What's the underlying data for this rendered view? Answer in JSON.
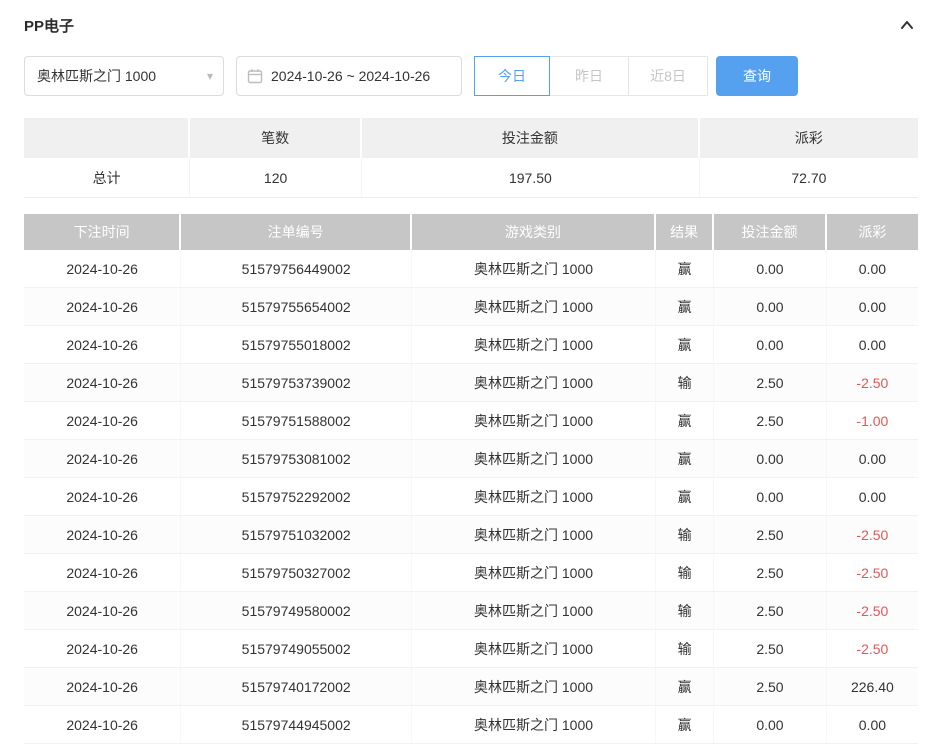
{
  "page": {
    "title": "PP电子"
  },
  "filters": {
    "game_select": "奥林匹斯之门 1000",
    "date_range": "2024-10-26 ~ 2024-10-26",
    "quick_buttons": [
      {
        "label": "今日",
        "active": true
      },
      {
        "label": "昨日",
        "active": false
      },
      {
        "label": "近8日",
        "active": false
      }
    ],
    "query_label": "查询"
  },
  "summary": {
    "headers": [
      "",
      "笔数",
      "投注金额",
      "派彩"
    ],
    "row": [
      "总计",
      "120",
      "197.50",
      "72.70"
    ]
  },
  "table": {
    "headers": [
      "下注时间",
      "注单编号",
      "游戏类别",
      "结果",
      "投注金额",
      "派彩"
    ],
    "rows": [
      [
        "2024-10-26",
        "51579756449002",
        "奥林匹斯之门 1000",
        "赢",
        "0.00",
        "0.00"
      ],
      [
        "2024-10-26",
        "51579755654002",
        "奥林匹斯之门 1000",
        "赢",
        "0.00",
        "0.00"
      ],
      [
        "2024-10-26",
        "51579755018002",
        "奥林匹斯之门 1000",
        "赢",
        "0.00",
        "0.00"
      ],
      [
        "2024-10-26",
        "51579753739002",
        "奥林匹斯之门 1000",
        "输",
        "2.50",
        "-2.50"
      ],
      [
        "2024-10-26",
        "51579751588002",
        "奥林匹斯之门 1000",
        "赢",
        "2.50",
        "-1.00"
      ],
      [
        "2024-10-26",
        "51579753081002",
        "奥林匹斯之门 1000",
        "赢",
        "0.00",
        "0.00"
      ],
      [
        "2024-10-26",
        "51579752292002",
        "奥林匹斯之门 1000",
        "赢",
        "0.00",
        "0.00"
      ],
      [
        "2024-10-26",
        "51579751032002",
        "奥林匹斯之门 1000",
        "输",
        "2.50",
        "-2.50"
      ],
      [
        "2024-10-26",
        "51579750327002",
        "奥林匹斯之门 1000",
        "输",
        "2.50",
        "-2.50"
      ],
      [
        "2024-10-26",
        "51579749580002",
        "奥林匹斯之门 1000",
        "输",
        "2.50",
        "-2.50"
      ],
      [
        "2024-10-26",
        "51579749055002",
        "奥林匹斯之门 1000",
        "输",
        "2.50",
        "-2.50"
      ],
      [
        "2024-10-26",
        "51579740172002",
        "奥林匹斯之门 1000",
        "赢",
        "2.50",
        "226.40"
      ],
      [
        "2024-10-26",
        "51579744945002",
        "奥林匹斯之门 1000",
        "赢",
        "0.00",
        "0.00"
      ]
    ]
  },
  "colors": {
    "accent": "#55a1f0",
    "negative": "#e25757",
    "table_header_bg": "#c6c6c6",
    "summary_header_bg": "#f0f0f0"
  }
}
